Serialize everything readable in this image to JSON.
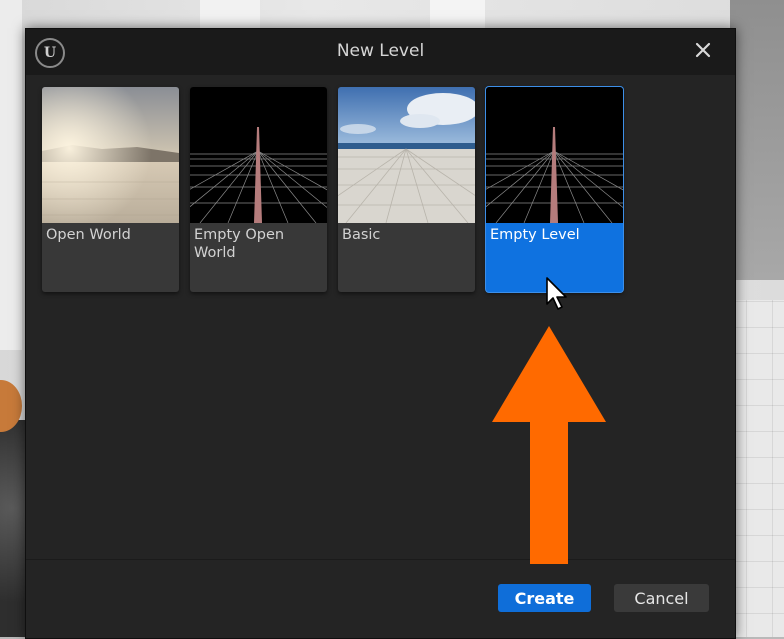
{
  "dialog": {
    "title": "New Level",
    "templates": [
      {
        "label": "Open World",
        "thumbnail": "open-world-thumbnail",
        "selected": false
      },
      {
        "label": "Empty Open World",
        "thumbnail": "empty-grid-thumbnail",
        "selected": false
      },
      {
        "label": "Basic",
        "thumbnail": "basic-floor-thumbnail",
        "selected": false
      },
      {
        "label": "Empty Level",
        "thumbnail": "empty-grid-thumbnail",
        "selected": true
      }
    ],
    "buttons": {
      "create_label": "Create",
      "cancel_label": "Cancel"
    }
  },
  "icons": {
    "logo": "unreal-engine-logo",
    "close": "close-icon",
    "cursor": "mouse-cursor",
    "annotation": "orange-up-arrow"
  },
  "colors": {
    "dialog_bg": "#242424",
    "titlebar_bg": "#1a1a1a",
    "tile_bg": "#383838",
    "selected_accent": "#0f72e0",
    "create_button": "#0f6ed9",
    "annotation_arrow": "#ff6a00"
  }
}
